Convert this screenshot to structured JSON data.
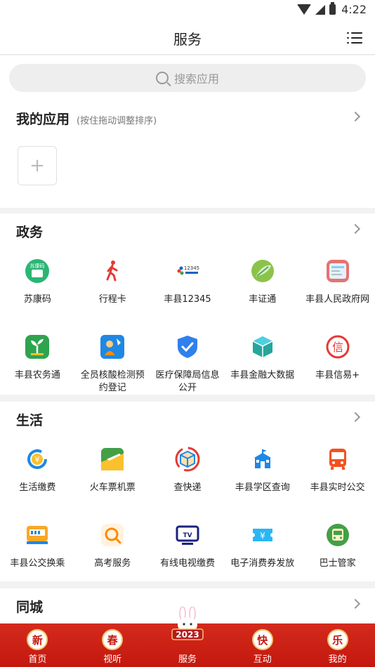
{
  "status": {
    "time": "4:22"
  },
  "header": {
    "title": "服务"
  },
  "search": {
    "placeholder": "搜索应用"
  },
  "my_apps": {
    "title": "我的应用",
    "hint": "(按住拖动调整排序)",
    "add_label": "+"
  },
  "sections": [
    {
      "title": "政务",
      "items": [
        {
          "label": "苏康码",
          "icon": "sukangma-icon",
          "color": "#2bb673"
        },
        {
          "label": "行程卡",
          "icon": "walking-person-icon",
          "color": "#e53935"
        },
        {
          "label": "丰县12345",
          "icon": "hotline-12345-icon",
          "color": "#1565c0"
        },
        {
          "label": "丰证通",
          "icon": "leaf-globe-icon",
          "color": "#6ab04c"
        },
        {
          "label": "丰县人民政府网",
          "icon": "government-site-icon",
          "color": "#e57373"
        },
        {
          "label": "丰县农务通",
          "icon": "sprout-icon",
          "color": "#2ea44f"
        },
        {
          "label": "全员核酸检测预约登记",
          "icon": "nucleic-test-icon",
          "color": "#1e88e5"
        },
        {
          "label": "医疗保障局信息公开",
          "icon": "shield-check-icon",
          "color": "#2f80ed"
        },
        {
          "label": "丰县金融大数据",
          "icon": "cube-data-icon",
          "color": "#26a69a"
        },
        {
          "label": "丰县信易+",
          "icon": "credit-xin-icon",
          "color": "#e53935"
        }
      ]
    },
    {
      "title": "生活",
      "items": [
        {
          "label": "生活缴费",
          "icon": "payment-yuan-icon",
          "color": "#1e88e5"
        },
        {
          "label": "火车票机票",
          "icon": "plane-train-icon",
          "color": "#43a047"
        },
        {
          "label": "查快递",
          "icon": "parcel-icon",
          "color": "#1e88e5"
        },
        {
          "label": "丰县学区查询",
          "icon": "school-icon",
          "color": "#1e88e5"
        },
        {
          "label": "丰县实时公交",
          "icon": "bus-icon",
          "color": "#f4511e"
        },
        {
          "label": "丰县公交换乘",
          "icon": "bus-card-icon",
          "color": "#f9a825"
        },
        {
          "label": "高考服务",
          "icon": "magnifier-icon",
          "color": "#fb8c00"
        },
        {
          "label": "有线电视缴费",
          "icon": "tv-icon",
          "color": "#1a237e"
        },
        {
          "label": "电子消费券发放",
          "icon": "coupon-yuan-icon",
          "color": "#29b6f6"
        },
        {
          "label": "巴士管家",
          "icon": "bus-manager-icon",
          "color": "#43a047"
        }
      ]
    },
    {
      "title": "同城",
      "items": []
    }
  ],
  "bottom_nav": [
    {
      "badge": "新",
      "label": "首页"
    },
    {
      "badge": "春",
      "label": "视听"
    },
    {
      "badge": "2023",
      "label": "服务"
    },
    {
      "badge": "快",
      "label": "互动"
    },
    {
      "badge": "乐",
      "label": "我的"
    }
  ],
  "colors": {
    "accent": "#c4180e",
    "nav_bg": "#d42a1d"
  }
}
